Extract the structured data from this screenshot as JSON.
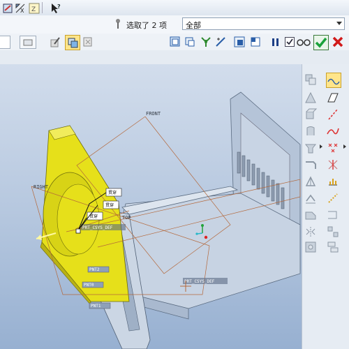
{
  "selection": {
    "status_text": "选取了 2 项",
    "filter_value": "全部"
  },
  "viewport": {
    "datum_front": "FRONT",
    "datum_right": "RIGHT",
    "datum_top": "TOP",
    "csys_def_1": "PRT_CSYS_DEF",
    "csys_def_2": "PRT_CSYS_DEF",
    "dim_tag_1": "贯穿",
    "dim_tag_2": "贯穿",
    "dim_tag_3": "贯穿",
    "side_tags": [
      "PNT0",
      "PNT1",
      "PNT2"
    ]
  },
  "icons": {
    "top_strip": [
      "edit-icon",
      "scale-icon",
      "grid-icon",
      "help-pointer-icon"
    ],
    "dashboard": [
      "pin-icon",
      "display-style-icon",
      "model-tree-icon",
      "datum-axis-icon",
      "pause-icon",
      "checkbox-icon",
      "preview-glasses-icon",
      "confirm-check-icon",
      "cancel-x-icon"
    ]
  },
  "colors": {
    "confirm": "#1aa23a",
    "cancel": "#d11a1a",
    "model": "#b8c8dc",
    "highlight": "#e6e01a"
  }
}
